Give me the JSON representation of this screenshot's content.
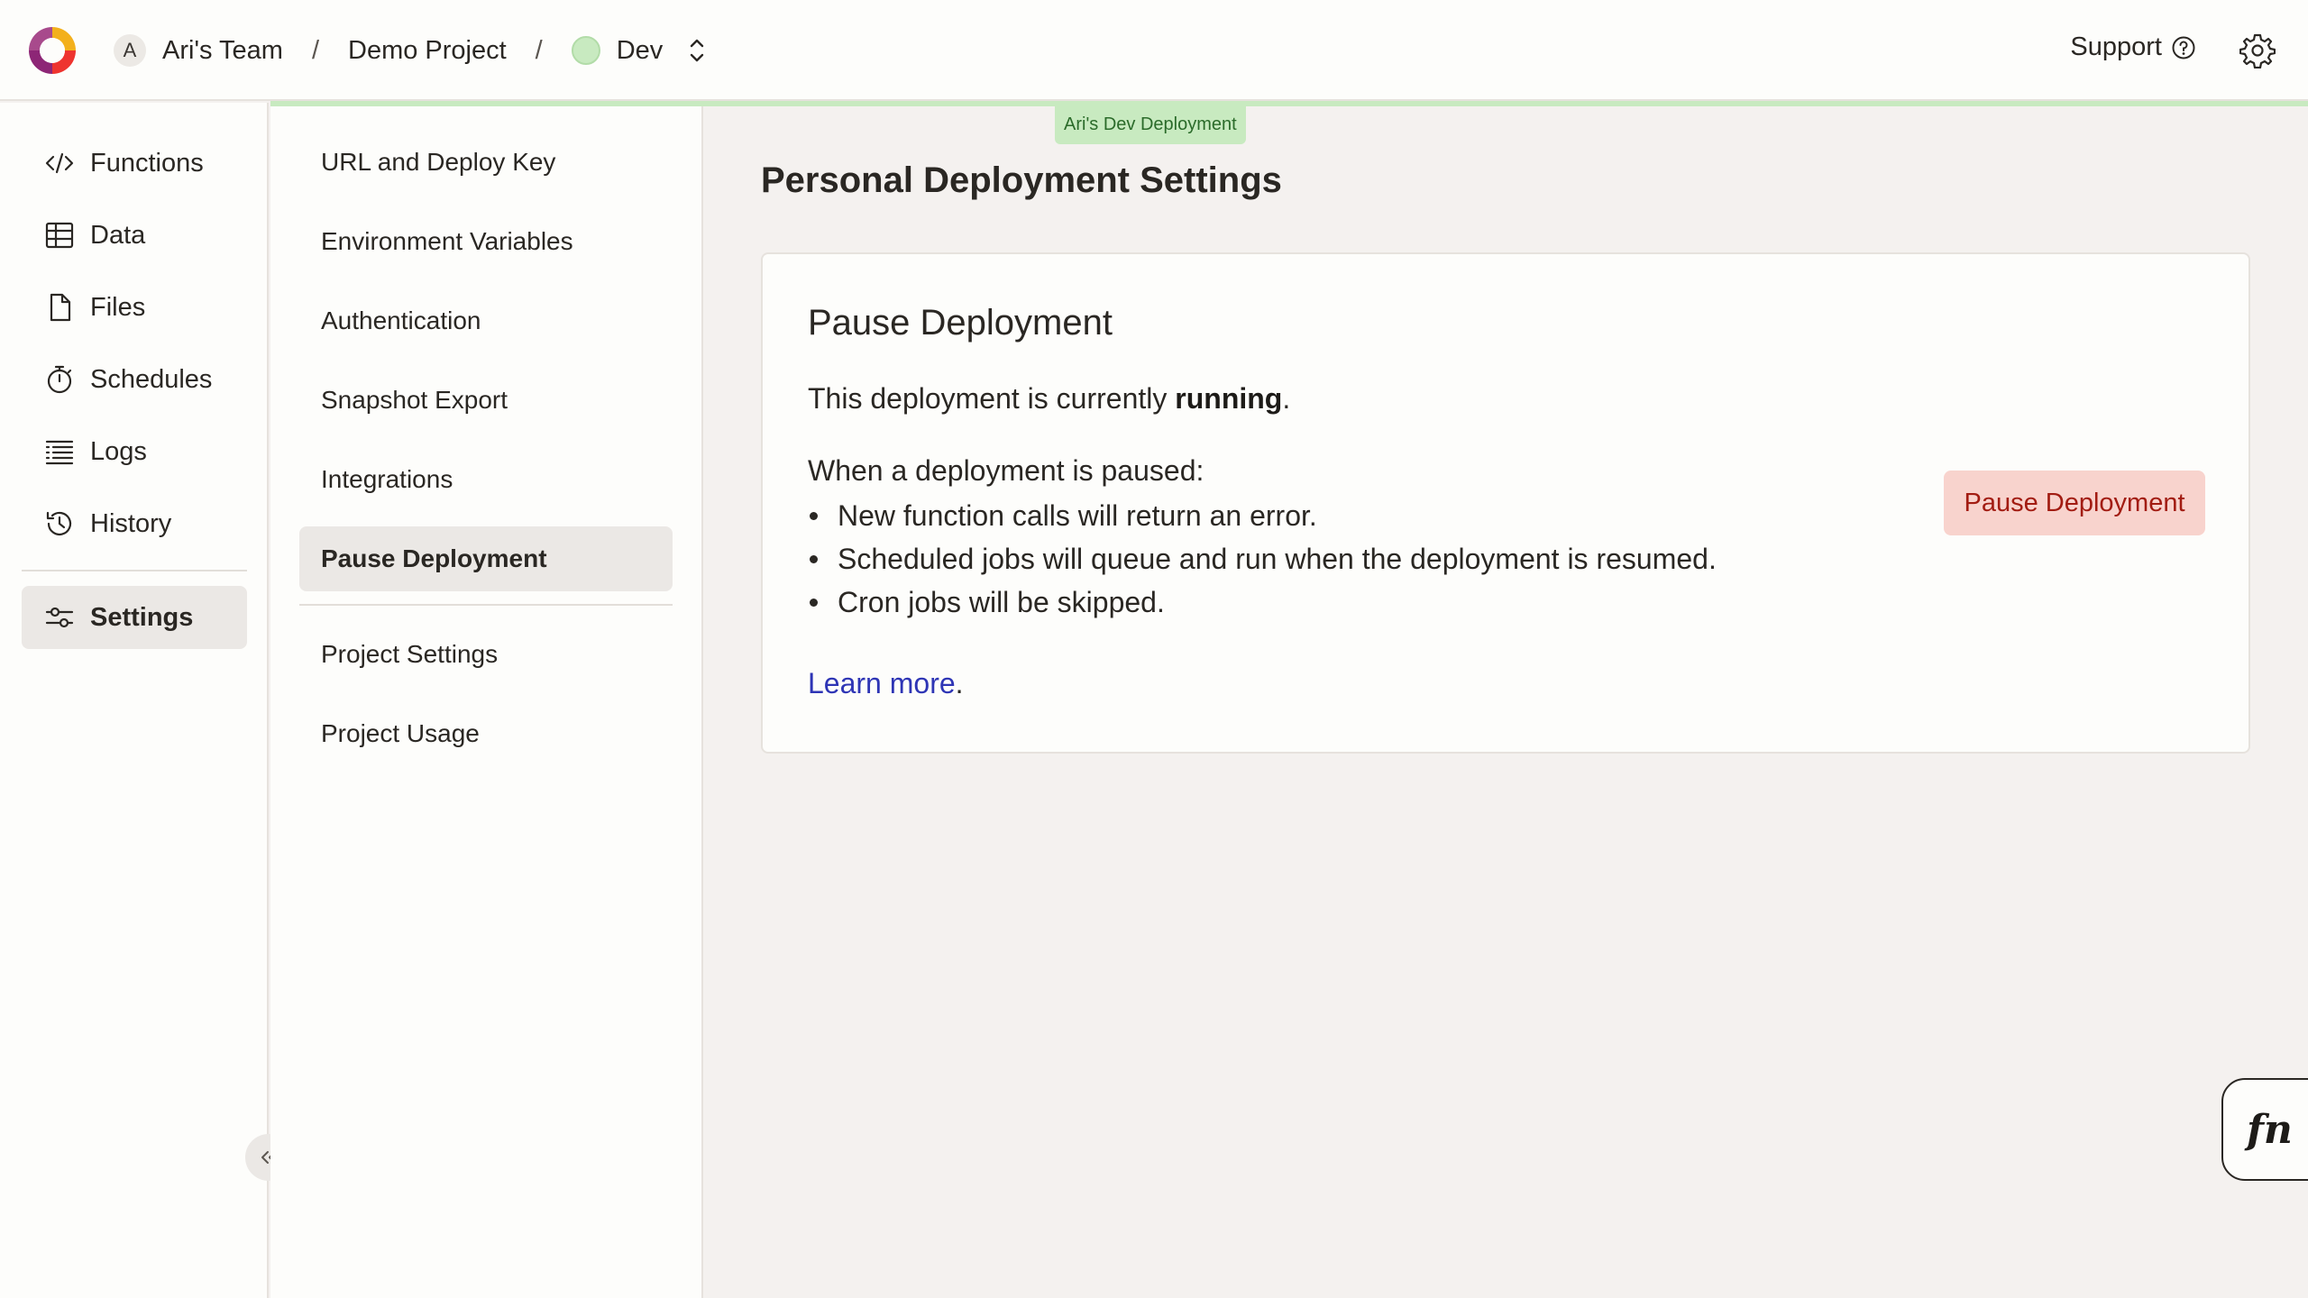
{
  "header": {
    "team_initial": "A",
    "team_name": "Ari's Team",
    "project_name": "Demo Project",
    "separator": "/",
    "deployment": "Dev",
    "support_label": "Support"
  },
  "deployment_tag": "Ari's Dev Deployment",
  "left_nav": {
    "items": [
      {
        "label": "Functions",
        "icon": "code-icon"
      },
      {
        "label": "Data",
        "icon": "table-icon"
      },
      {
        "label": "Files",
        "icon": "file-icon"
      },
      {
        "label": "Schedules",
        "icon": "stopwatch-icon"
      },
      {
        "label": "Logs",
        "icon": "list-icon"
      },
      {
        "label": "History",
        "icon": "history-icon"
      }
    ],
    "settings_label": "Settings"
  },
  "settings_nav": {
    "items": [
      "URL and Deploy Key",
      "Environment Variables",
      "Authentication",
      "Snapshot Export",
      "Integrations",
      "Pause Deployment"
    ],
    "project_items": [
      "Project Settings",
      "Project Usage"
    ],
    "active": "Pause Deployment"
  },
  "main": {
    "page_title": "Personal Deployment Settings",
    "card": {
      "title": "Pause Deployment",
      "status_prefix": "This deployment is currently ",
      "status_value": "running",
      "status_suffix": ".",
      "when_label": "When a deployment is paused:",
      "bullets": [
        "New function calls will return an error.",
        "Scheduled jobs will queue and run when the deployment is resumed.",
        "Cron jobs will be skipped."
      ],
      "learn_more": "Learn more",
      "learn_more_suffix": ".",
      "pause_button": "Pause Deployment"
    }
  },
  "fn_button": "fn",
  "colors": {
    "accent_green": "#c8eac0",
    "danger_bg": "#f8d3cd",
    "danger_text": "#a21c12",
    "link": "#2e35b5"
  }
}
